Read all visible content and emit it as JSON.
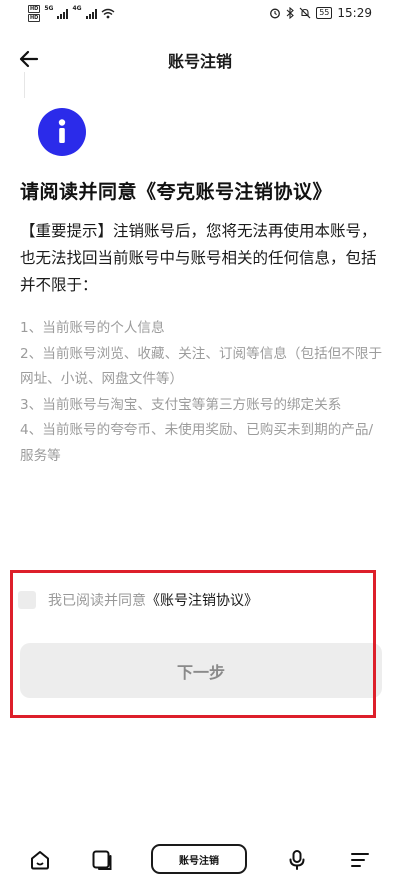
{
  "status_bar": {
    "sim1": [
      "HD",
      "HD"
    ],
    "net1": "5G",
    "net2": "4G",
    "battery": "55",
    "time": "15:29"
  },
  "header": {
    "title": "账号注销"
  },
  "content": {
    "headline": "请阅读并同意《夸克账号注销协议》",
    "notice": "【重要提示】注销账号后，您将无法再使用本账号，也无法找回当前账号中与账号相关的任何信息，包括并不限于：",
    "terms": [
      "1、当前账号的个人信息",
      "2、当前账号浏览、收藏、关注、订阅等信息（包括但不限于网址、小说、网盘文件等）",
      "3、当前账号与淘宝、支付宝等第三方账号的绑定关系",
      "4、当前账号的夸夸币、未使用奖励、已购买未到期的产品/服务等"
    ]
  },
  "agreement": {
    "text": "我已阅读并同意",
    "link": "《账号注销协议》",
    "checked": false
  },
  "next_button": {
    "label": "下一步",
    "enabled": false
  },
  "bottom_bar": {
    "pill_label": "账号注销"
  },
  "colors": {
    "accent": "#2b2bea",
    "highlight": "#dd1f2a",
    "muted_text": "#9c9c9c"
  }
}
